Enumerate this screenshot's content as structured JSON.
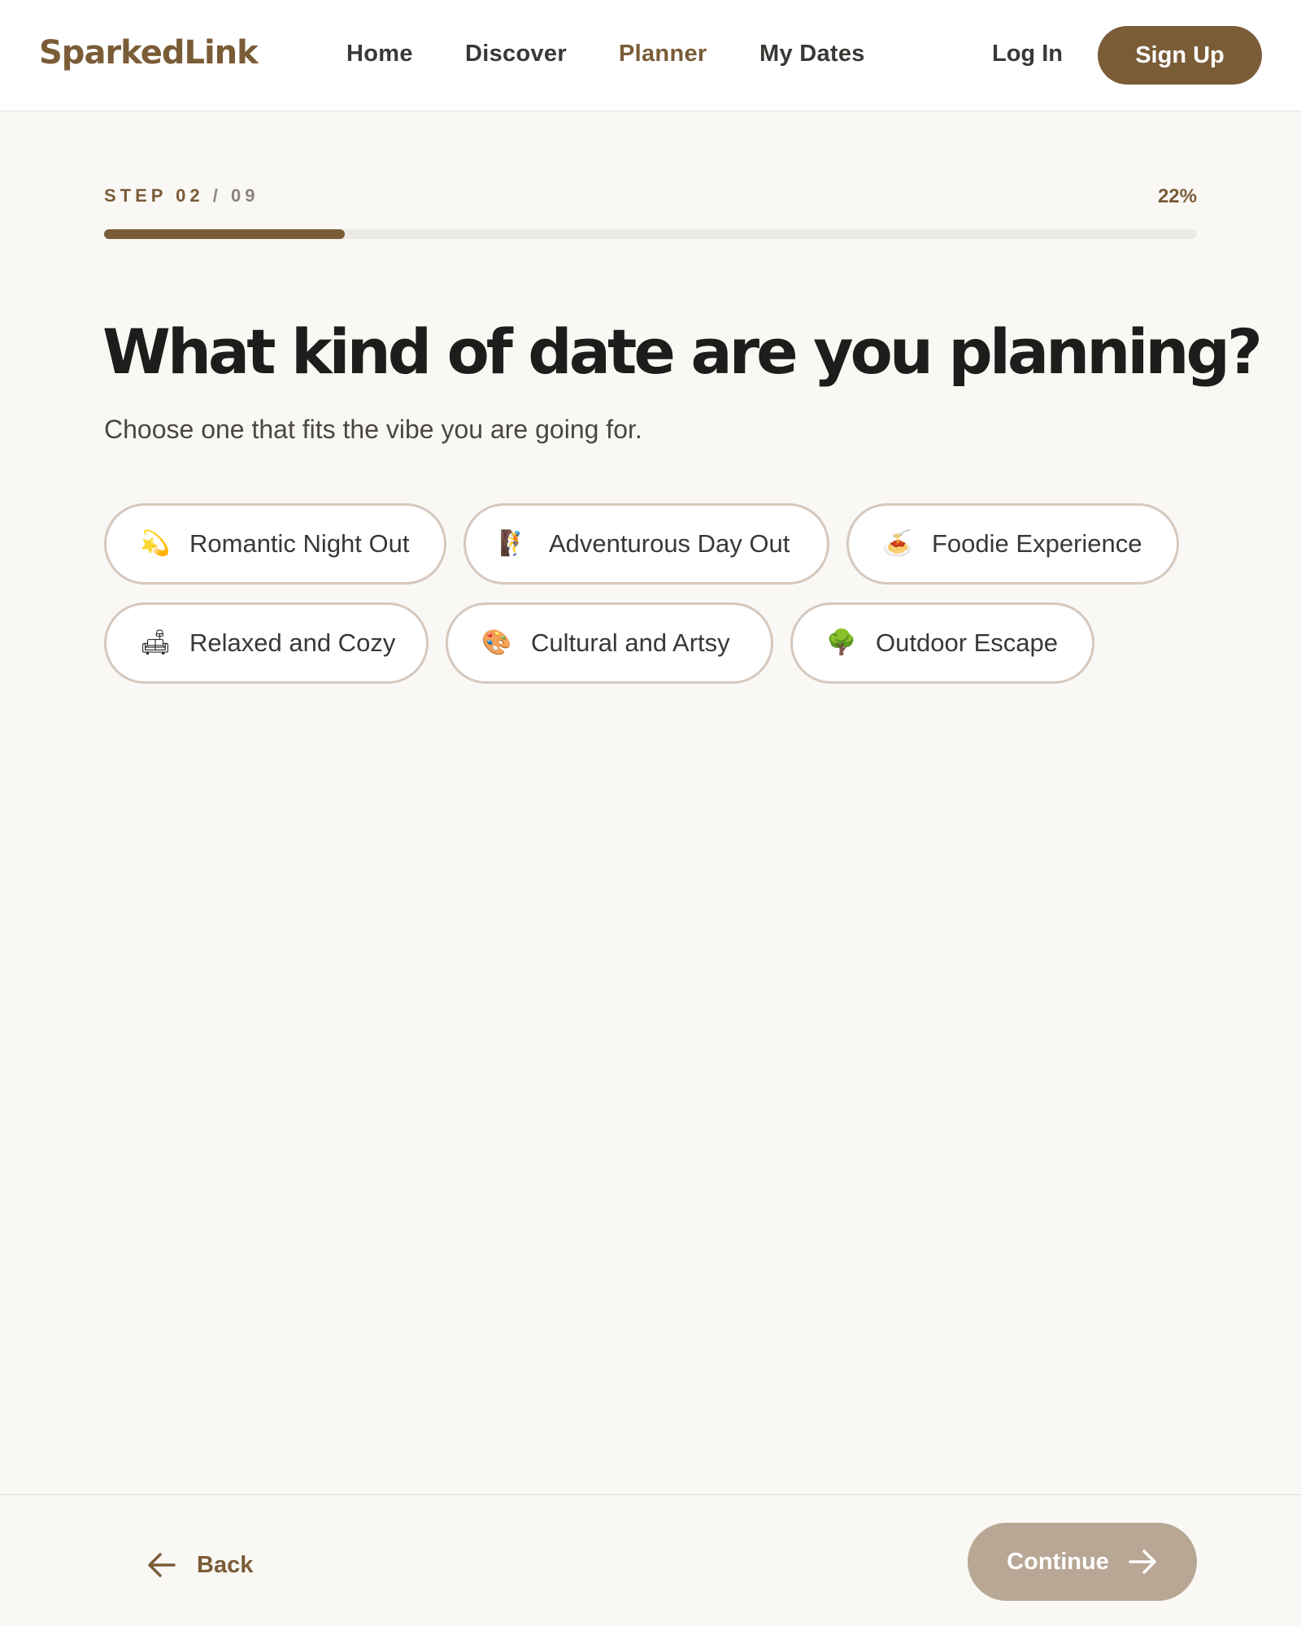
{
  "brand": {
    "logo_text": "SparkedLink",
    "accent_color": "#7a5c37"
  },
  "nav": {
    "items": [
      {
        "label": "Home",
        "active": false
      },
      {
        "label": "Discover",
        "active": false
      },
      {
        "label": "Planner",
        "active": true
      },
      {
        "label": "My Dates",
        "active": false
      }
    ],
    "login_label": "Log In",
    "signup_label": "Sign Up"
  },
  "progress": {
    "step_current": "STEP 02",
    "step_total": " / 09",
    "percent_label": "22%",
    "fraction": 0.22
  },
  "question": {
    "title": "What kind of date are you planning?",
    "subtitle": "Choose one that fits the vibe you are going for."
  },
  "options": [
    {
      "label": "Romantic Night Out",
      "icon": "sparkle-moon-icon",
      "glyph": "💫"
    },
    {
      "label": "Adventurous Day Out",
      "icon": "climbing-icon",
      "glyph": "🧗"
    },
    {
      "label": "Foodie Experience",
      "icon": "spaghetti-icon",
      "glyph": "🍝"
    },
    {
      "label": "Relaxed and Cozy",
      "icon": "couch-icon",
      "glyph": "🛋"
    },
    {
      "label": "Cultural and Artsy",
      "icon": "palette-icon",
      "glyph": "🎨"
    },
    {
      "label": "Outdoor Escape",
      "icon": "tree-icon",
      "glyph": "🌳"
    }
  ],
  "footer": {
    "back_label": "Back",
    "continue_label": "Continue",
    "continue_color": "#b8a794"
  }
}
